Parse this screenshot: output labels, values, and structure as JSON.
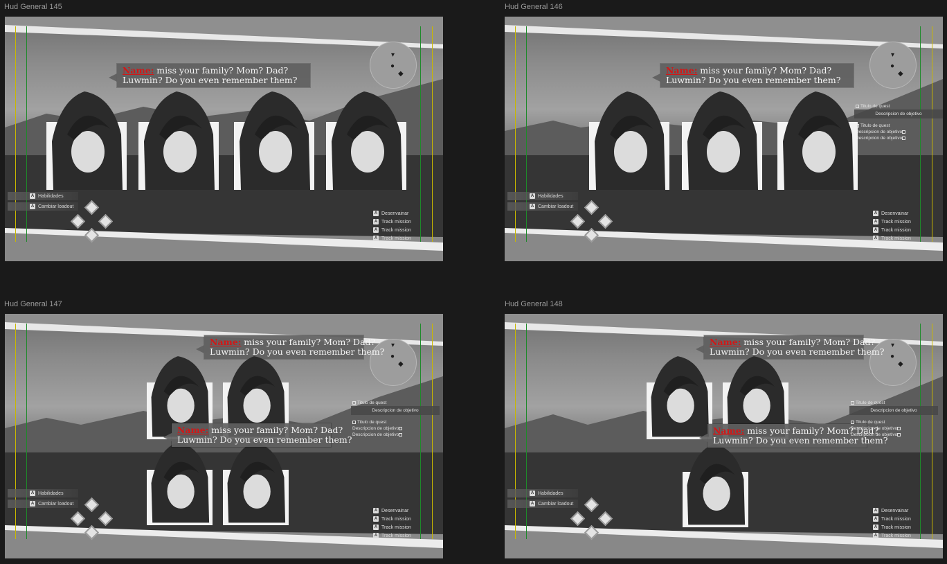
{
  "frames": [
    {
      "label": "Hud General 145"
    },
    {
      "label": "Hud General 146"
    },
    {
      "label": "Hud General 147"
    },
    {
      "label": "Hud General 148"
    }
  ],
  "dialogue": {
    "name": "Name:",
    "line1": " miss your family? Mom? Dad?",
    "line2": "Luwmin? Do you even remember them?"
  },
  "quest": {
    "title": "Titulo de quest",
    "description": "Descripcion de objetivo",
    "objective_1": "Descripcion de objetivo",
    "objective_2": "Descripcion de objetivo"
  },
  "left_buttons": {
    "skills": "Habilidades",
    "loadout": "Cambiar loadout"
  },
  "right_actions": {
    "unsheathe": "Desenvainar",
    "track_1": "Track mission",
    "track_2": "Track mission",
    "track_3": "Track mission"
  },
  "keys": {
    "a": "A"
  },
  "colors": {
    "name_red": "#d01818",
    "guide_yellow": "#c9b800",
    "guide_green": "#1e8a2a"
  }
}
